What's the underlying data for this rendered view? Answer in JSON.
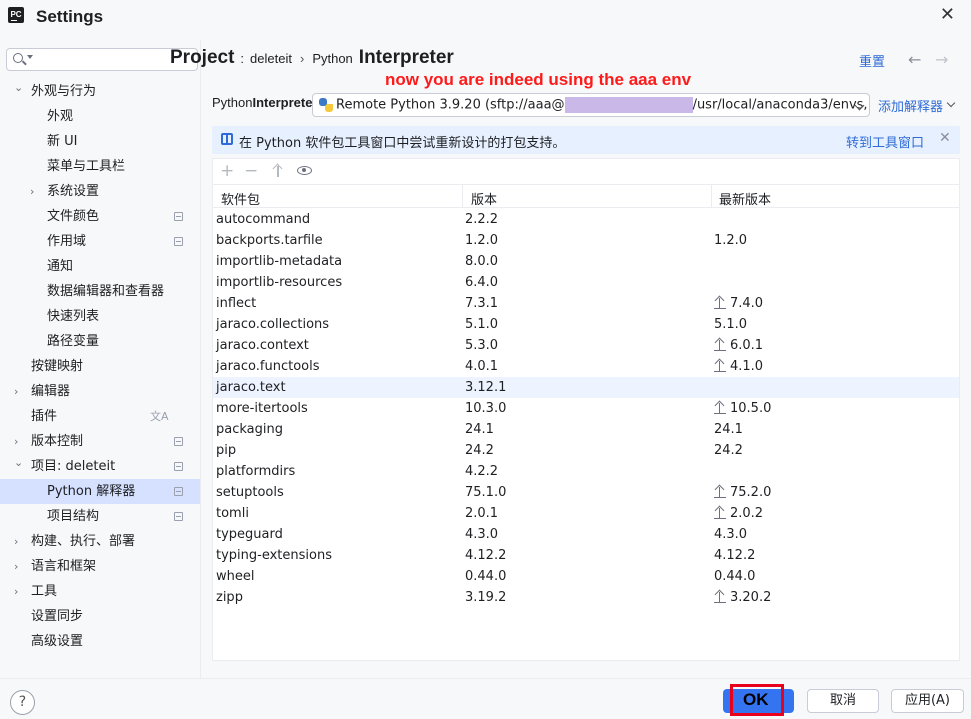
{
  "window": {
    "app_icon_text": "PC",
    "title": "Settings",
    "close_glyph": "✕"
  },
  "search": {
    "placeholder": ""
  },
  "sidebar": {
    "items": [
      {
        "label": "外观与行为",
        "level": 0,
        "expanded": true
      },
      {
        "label": "外观",
        "level": 1
      },
      {
        "label": "新 UI",
        "level": 1
      },
      {
        "label": "菜单与工具栏",
        "level": 1
      },
      {
        "label": "系统设置",
        "level": 1,
        "collapsed": true
      },
      {
        "label": "文件颜色",
        "level": 1,
        "badge": "project-icon"
      },
      {
        "label": "作用域",
        "level": 1,
        "badge": "project-icon"
      },
      {
        "label": "通知",
        "level": 1
      },
      {
        "label": "数据编辑器和查看器",
        "level": 1
      },
      {
        "label": "快速列表",
        "level": 1
      },
      {
        "label": "路径变量",
        "level": 1
      },
      {
        "label": "按键映射",
        "level": 0
      },
      {
        "label": "编辑器",
        "level": 0,
        "collapsed": true
      },
      {
        "label": "插件",
        "level": 0,
        "badge": "translate-icon"
      },
      {
        "label": "版本控制",
        "level": 0,
        "collapsed": true,
        "badge": "project-icon"
      },
      {
        "label": "项目: deleteit",
        "level": 0,
        "expanded": true,
        "badge": "project-icon"
      },
      {
        "label": "Python 解释器",
        "level": 1,
        "selected": true,
        "badge": "project-icon"
      },
      {
        "label": "项目结构",
        "level": 1,
        "badge": "project-icon"
      },
      {
        "label": "构建、执行、部署",
        "level": 0,
        "collapsed": true
      },
      {
        "label": "语言和框架",
        "level": 0,
        "collapsed": true
      },
      {
        "label": "工具",
        "level": 0,
        "collapsed": true
      },
      {
        "label": "设置同步",
        "level": 0
      },
      {
        "label": "高级设置",
        "level": 0
      }
    ],
    "translate_glyph": "文A"
  },
  "header": {
    "breadcrumb_project": "Project",
    "breadcrumb_colon": ":",
    "breadcrumb_project_name": "deleteit",
    "breadcrumb_sep": "›",
    "breadcrumb_python": "Python",
    "breadcrumb_interpreter": "Interpreter",
    "reset_label": "重置",
    "back_glyph": "←",
    "forward_glyph": "→"
  },
  "annotation": {
    "text": "now you are indeed using the aaa env",
    "color": "#ff1a1a"
  },
  "interpreter": {
    "label_prefix": "Python",
    "label_bold": "Interpreter",
    "value_prefix": "Remote Python 3.9.20 (sftp://aaa@",
    "value_suffix": "/usr/local/anaconda3/envs,",
    "add_label": "添加解释器"
  },
  "banner": {
    "text": "在 Python 软件包工具窗口中尝试重新设计的打包支持。",
    "link": "转到工具窗口",
    "close_glyph": "✕"
  },
  "toolbar": {
    "add_glyph": "+",
    "remove_glyph": "−"
  },
  "table": {
    "columns": [
      "软件包",
      "版本",
      "最新版本"
    ],
    "rows": [
      {
        "package": "autocommand",
        "version": "2.2.2",
        "latest": "",
        "upgrade": false
      },
      {
        "package": "backports.tarfile",
        "version": "1.2.0",
        "latest": "1.2.0",
        "upgrade": false
      },
      {
        "package": "importlib-metadata",
        "version": "8.0.0",
        "latest": "",
        "upgrade": false
      },
      {
        "package": "importlib-resources",
        "version": "6.4.0",
        "latest": "",
        "upgrade": false
      },
      {
        "package": "inflect",
        "version": "7.3.1",
        "latest": "7.4.0",
        "upgrade": true
      },
      {
        "package": "jaraco.collections",
        "version": "5.1.0",
        "latest": "5.1.0",
        "upgrade": false
      },
      {
        "package": "jaraco.context",
        "version": "5.3.0",
        "latest": "6.0.1",
        "upgrade": true
      },
      {
        "package": "jaraco.functools",
        "version": "4.0.1",
        "latest": "4.1.0",
        "upgrade": true
      },
      {
        "package": "jaraco.text",
        "version": "3.12.1",
        "latest": "",
        "upgrade": false,
        "highlighted": true
      },
      {
        "package": "more-itertools",
        "version": "10.3.0",
        "latest": "10.5.0",
        "upgrade": true
      },
      {
        "package": "packaging",
        "version": "24.1",
        "latest": "24.1",
        "upgrade": false
      },
      {
        "package": "pip",
        "version": "24.2",
        "latest": "24.2",
        "upgrade": false
      },
      {
        "package": "platformdirs",
        "version": "4.2.2",
        "latest": "",
        "upgrade": false
      },
      {
        "package": "setuptools",
        "version": "75.1.0",
        "latest": "75.2.0",
        "upgrade": true
      },
      {
        "package": "tomli",
        "version": "2.0.1",
        "latest": "2.0.2",
        "upgrade": true
      },
      {
        "package": "typeguard",
        "version": "4.3.0",
        "latest": "4.3.0",
        "upgrade": false
      },
      {
        "package": "typing-extensions",
        "version": "4.12.2",
        "latest": "4.12.2",
        "upgrade": false
      },
      {
        "package": "wheel",
        "version": "0.44.0",
        "latest": "0.44.0",
        "upgrade": false
      },
      {
        "package": "zipp",
        "version": "3.19.2",
        "latest": "3.20.2",
        "upgrade": true
      }
    ]
  },
  "footer": {
    "help_label": "?",
    "ok_label": "OK",
    "cancel_label": "取消",
    "apply_label": "应用(A)",
    "highlight_color": "#e8001c"
  }
}
